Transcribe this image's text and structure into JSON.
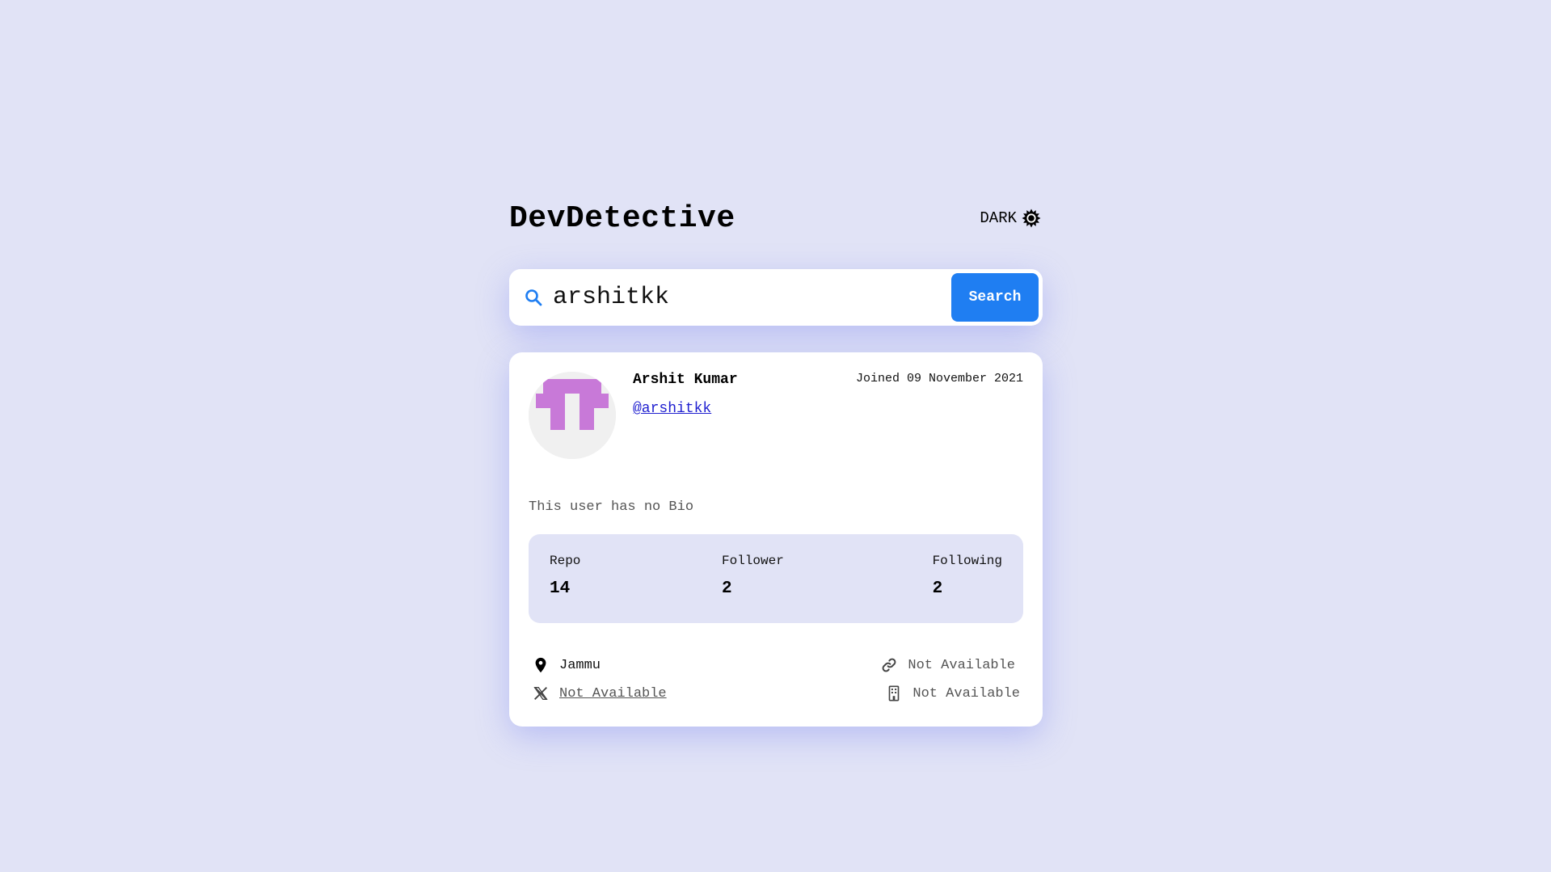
{
  "header": {
    "title": "DevDetective",
    "theme_label": "DARK",
    "theme_icon": "sun-icon"
  },
  "search": {
    "icon": "search-icon",
    "value": "arshitkk",
    "placeholder": "",
    "button_label": "Search"
  },
  "profile": {
    "name": "Arshit Kumar",
    "handle": "@arshitkk",
    "joined": "Joined 09 November 2021",
    "bio": "This user has no Bio",
    "avatar_color": "#c879d8"
  },
  "stats": {
    "repo_label": "Repo",
    "repo_value": "14",
    "follower_label": "Follower",
    "follower_value": "2",
    "following_label": "Following",
    "following_value": "2"
  },
  "links": {
    "location": "Jammu",
    "blog": "Not Available",
    "twitter": "Not Available",
    "company": "Not Available"
  },
  "colors": {
    "background": "#e1e3f6",
    "accent": "#1f7ef2",
    "handle_link": "#2020d0"
  }
}
